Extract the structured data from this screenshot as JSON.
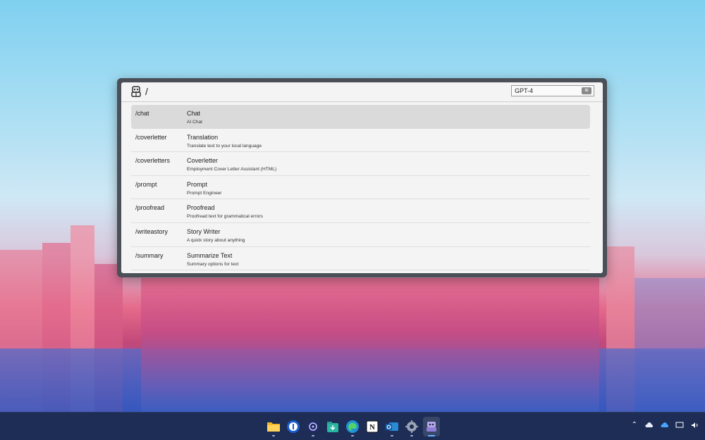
{
  "launcher": {
    "query": "/",
    "model": "GPT-4",
    "model_key_hint": "⌘"
  },
  "commands": [
    {
      "command": "/chat",
      "title": "Chat",
      "description": "AI Chat"
    },
    {
      "command": "/coverletter",
      "title": "Translation",
      "description": "Translate text to your local language"
    },
    {
      "command": "/coverletters",
      "title": "Coverletter",
      "description": "Employment Cover Letter Assistant (HTML)"
    },
    {
      "command": "/prompt",
      "title": "Prompt",
      "description": "Prompt Engineer"
    },
    {
      "command": "/proofread",
      "title": "Proofread",
      "description": "Proofread text for grammatical errors"
    },
    {
      "command": "/writeastory",
      "title": "Story Writer",
      "description": "A quick story about anything"
    },
    {
      "command": "/summary",
      "title": "Summarize Text",
      "description": "Summary options for text"
    }
  ],
  "selected_index": 0,
  "taskbar": {
    "apps": [
      "file-explorer-icon",
      "1password-icon",
      "obs-icon",
      "store-download-icon",
      "edge-icon",
      "notion-icon",
      "outlook-icon",
      "settings-icon",
      "ai-launcher-icon"
    ],
    "active": "ai-launcher-icon"
  },
  "colors": {
    "accent": "#6fb3ff",
    "selection": "#dadada",
    "taskbar": "#1d2d55"
  }
}
